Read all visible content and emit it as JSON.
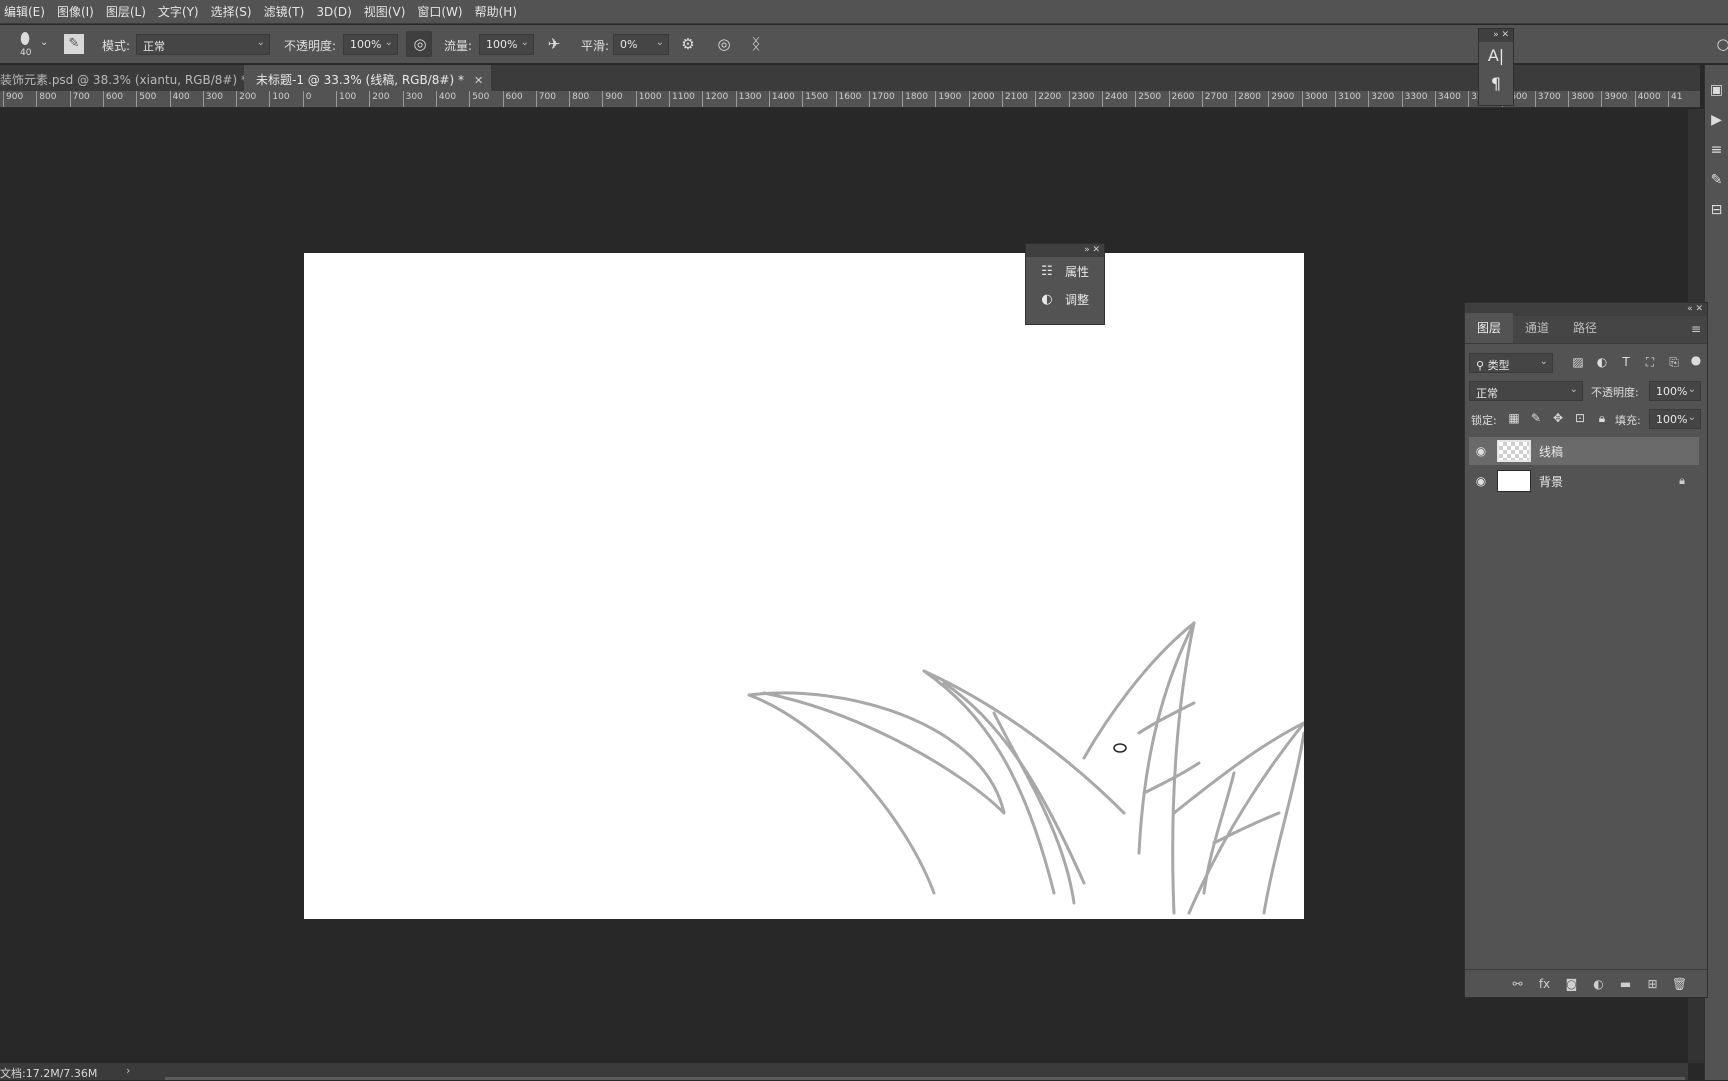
{
  "menu": [
    "编辑(E)",
    "图像(I)",
    "图层(L)",
    "文字(Y)",
    "选择(S)",
    "滤镜(T)",
    "3D(D)",
    "视图(V)",
    "窗口(W)",
    "帮助(H)"
  ],
  "options": {
    "brush_size": "40",
    "mode_label": "模式:",
    "mode_value": "正常",
    "opacity_label": "不透明度:",
    "opacity_value": "100%",
    "flow_label": "流量:",
    "flow_value": "100%",
    "smoothing_label": "平滑:",
    "smoothing_value": "0%"
  },
  "tabs": [
    {
      "title": "装饰元素.psd @ 38.3% (xiantu, RGB/8#) *",
      "active": false
    },
    {
      "title": "未标题-1 @ 33.3% (线稿, RGB/8#) *",
      "active": true
    }
  ],
  "ruler_ticks": [
    "900",
    "800",
    "700",
    "600",
    "500",
    "400",
    "300",
    "200",
    "100",
    "0",
    "100",
    "200",
    "300",
    "400",
    "500",
    "600",
    "700",
    "800",
    "900",
    "1000",
    "1100",
    "1200",
    "1300",
    "1400",
    "1500",
    "1600",
    "1700",
    "1800",
    "1900",
    "2000",
    "2100",
    "2200",
    "2300",
    "2400",
    "2500",
    "2600",
    "2700",
    "2800",
    "2900",
    "3000",
    "3100",
    "3200",
    "3300",
    "3400",
    "3500",
    "3600",
    "3700",
    "3800",
    "3900",
    "4000",
    "41"
  ],
  "float_panel": {
    "items": [
      {
        "label": "属性",
        "icon": "properties-icon"
      },
      {
        "label": "调整",
        "icon": "adjustments-icon"
      }
    ]
  },
  "char_panel": {
    "items": [
      "A|",
      "¶"
    ]
  },
  "layers_panel": {
    "tabs": [
      "图层",
      "通道",
      "路径"
    ],
    "filter_label": "类型",
    "blend_mode": "正常",
    "opacity_label": "不透明度:",
    "opacity_value": "100%",
    "lock_label": "锁定:",
    "fill_label": "填充:",
    "fill_value": "100%",
    "layers": [
      {
        "name": "线稿",
        "selected": true,
        "transparent": true,
        "locked": false
      },
      {
        "name": "背景",
        "selected": false,
        "transparent": false,
        "locked": true
      }
    ]
  },
  "status": {
    "doc_size": "文档:17.2M/7.36M"
  },
  "colors": {
    "canvas": "#ffffff",
    "workspace": "#282828",
    "panel": "#535353",
    "stroke": "#9a9a9a"
  }
}
